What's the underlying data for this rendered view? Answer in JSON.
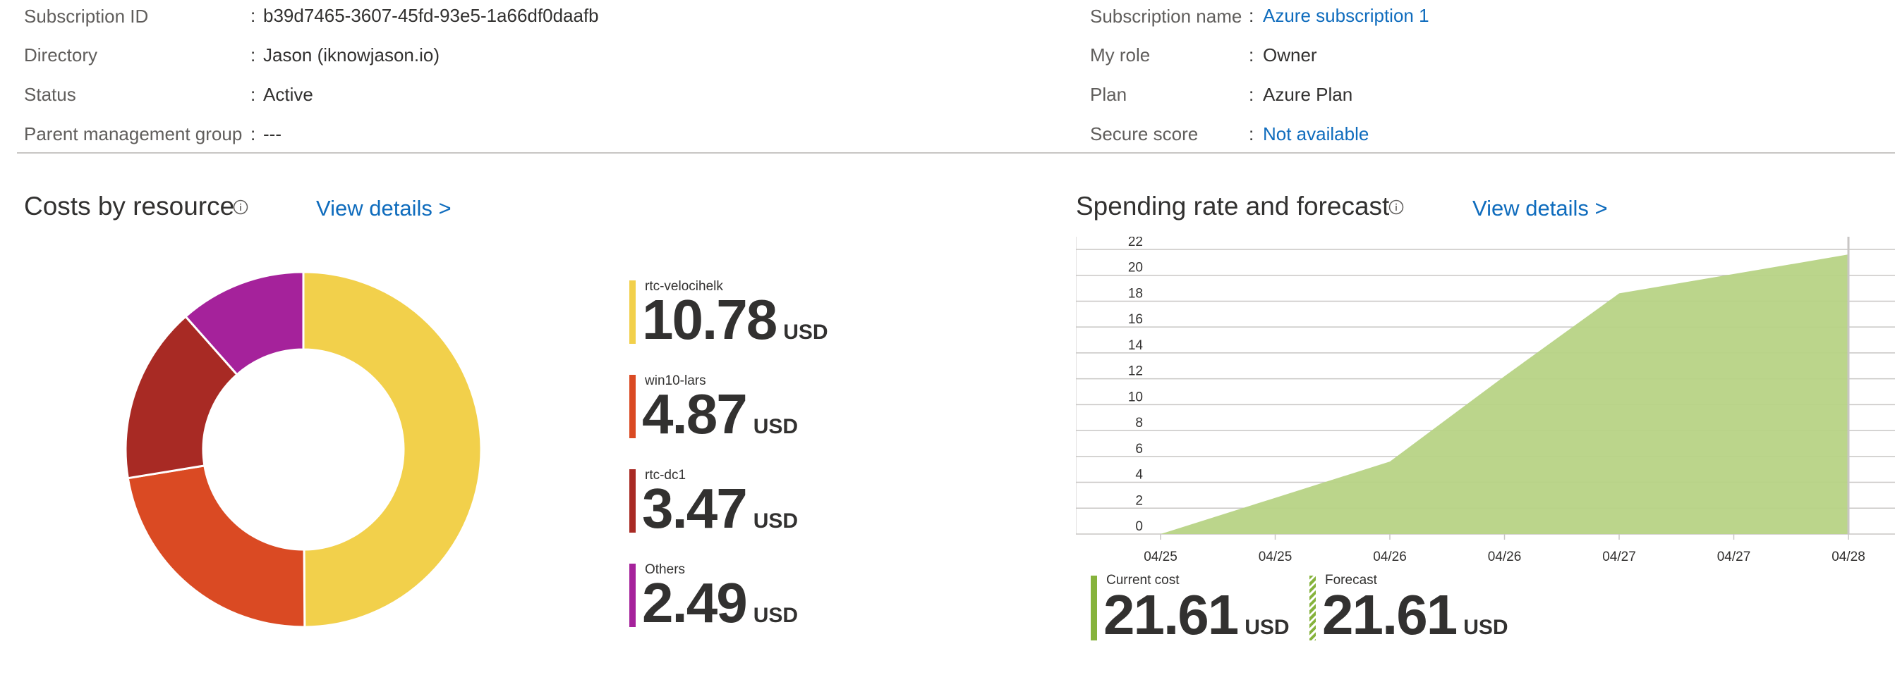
{
  "essentials": {
    "left": [
      {
        "label": "Subscription ID",
        "value": "b39d7465-3607-45fd-93e5-1a66df0daafb",
        "link": false
      },
      {
        "label": "Directory",
        "value": "Jason (iknowjason.io)",
        "link": false
      },
      {
        "label": "Status",
        "value": "Active",
        "link": false
      },
      {
        "label": "Parent management group",
        "value": "---",
        "link": false
      }
    ],
    "right": [
      {
        "label": "Subscription name",
        "value": "Azure subscription 1",
        "link": true
      },
      {
        "label": "My role",
        "value": "Owner",
        "link": false
      },
      {
        "label": "Plan",
        "value": "Azure Plan",
        "link": false
      },
      {
        "label": "Secure score",
        "value": "Not available",
        "link": true
      }
    ],
    "separator": ":"
  },
  "costs_by_resource": {
    "title": "Costs by resource",
    "view_details": "View details >",
    "items": [
      {
        "name": "rtc-velocihelk",
        "value": "10.78",
        "unit": "USD",
        "color": "#f2d04b"
      },
      {
        "name": "win10-lars",
        "value": "4.87",
        "unit": "USD",
        "color": "#da4a23"
      },
      {
        "name": "rtc-dc1",
        "value": "3.47",
        "unit": "USD",
        "color": "#a82a24"
      },
      {
        "name": "Others",
        "value": "2.49",
        "unit": "USD",
        "color": "#a5229b"
      }
    ]
  },
  "spending": {
    "title": "Spending rate and forecast",
    "view_details": "View details >",
    "current": {
      "label": "Current cost",
      "value": "21.61",
      "unit": "USD",
      "color": "#86b33c"
    },
    "forecast": {
      "label": "Forecast",
      "value": "21.61",
      "unit": "USD",
      "color": "#86b33c"
    }
  },
  "chart_data": [
    {
      "type": "pie",
      "categories": [
        "rtc-velocihelk",
        "win10-lars",
        "rtc-dc1",
        "Others"
      ],
      "values": [
        10.78,
        4.87,
        3.47,
        2.49
      ],
      "colors": [
        "#f2d04b",
        "#da4a23",
        "#a82a24",
        "#a5229b"
      ],
      "donut": true,
      "legend": "right"
    },
    {
      "type": "area",
      "x": [
        "04/25",
        "04/25",
        "04/26",
        "04/26",
        "04/27",
        "04/27",
        "04/28"
      ],
      "series": [
        {
          "values": [
            0,
            2.8,
            5.6,
            12.2,
            18.6,
            20.1,
            21.61
          ],
          "color": "#b7d385"
        }
      ],
      "ylim": [
        0,
        22
      ],
      "yticks": [
        0,
        2,
        4,
        6,
        8,
        10,
        12,
        14,
        16,
        18,
        20,
        22
      ],
      "grid": true
    }
  ]
}
